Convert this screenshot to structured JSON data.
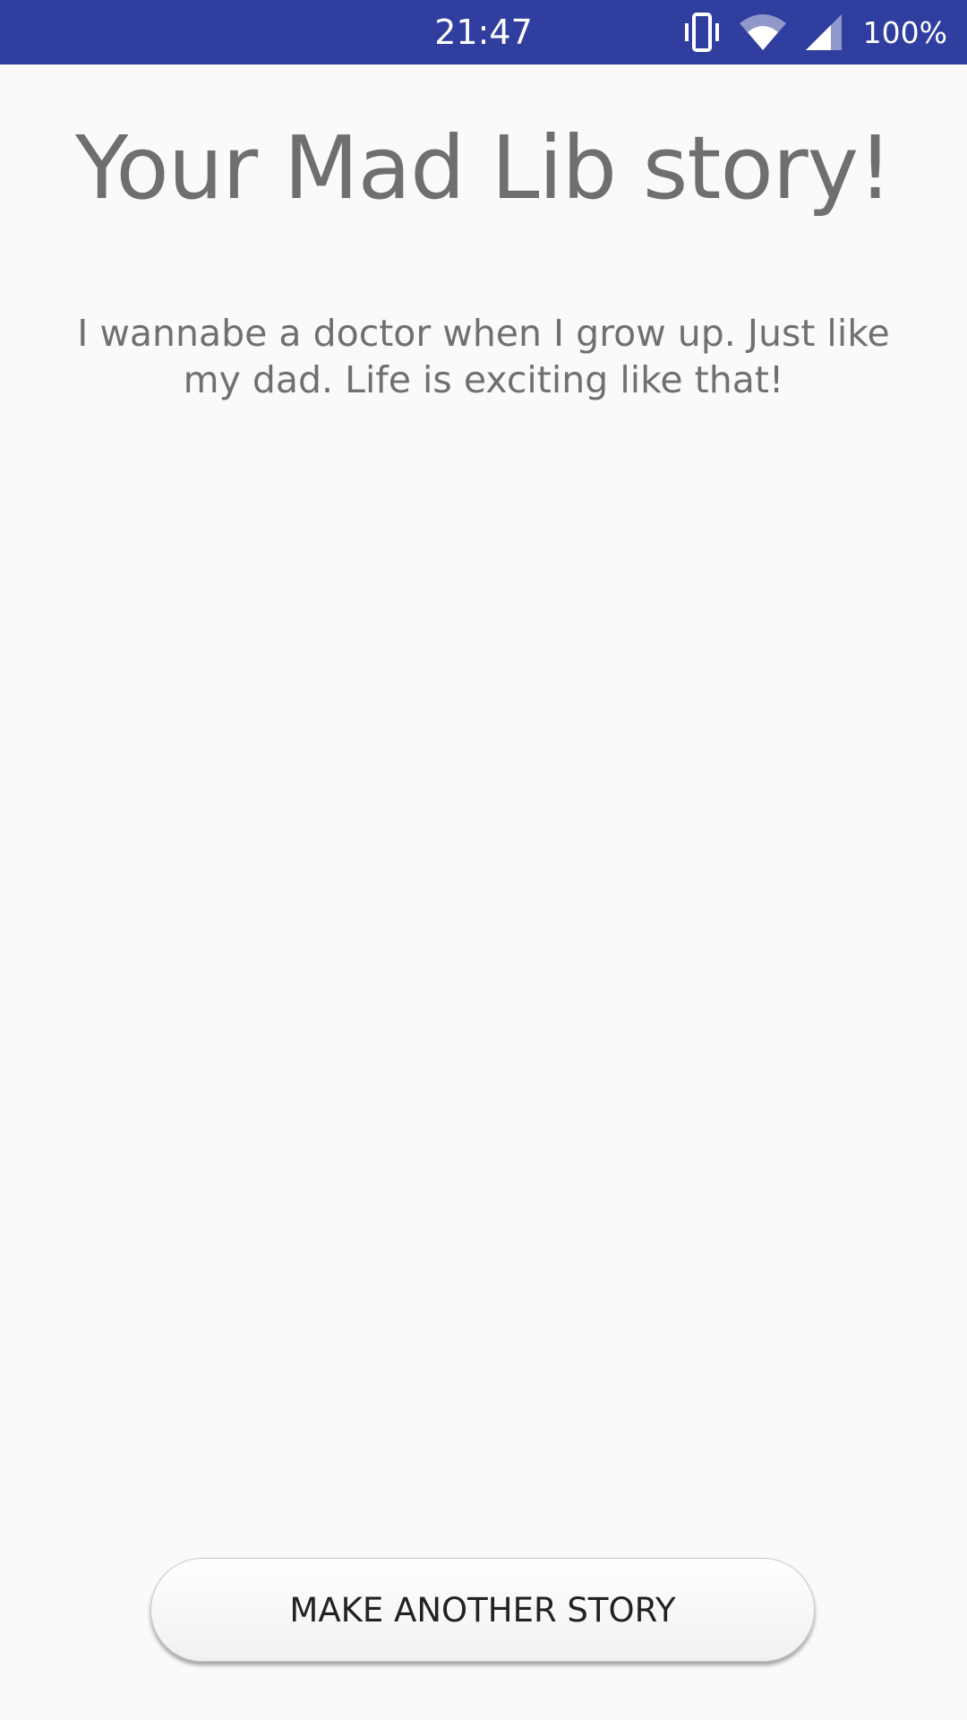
{
  "status_bar": {
    "time": "21:47",
    "battery": "100%",
    "background": "#303f9f",
    "icons": [
      "vibrate-icon",
      "wifi-icon",
      "signal-icon"
    ]
  },
  "page": {
    "title": "Your Mad Lib story!",
    "story": "I wannabe a doctor when I grow up. Just like my dad. Life is exciting like that!"
  },
  "actions": {
    "make_another_label": "MAKE ANOTHER STORY"
  }
}
